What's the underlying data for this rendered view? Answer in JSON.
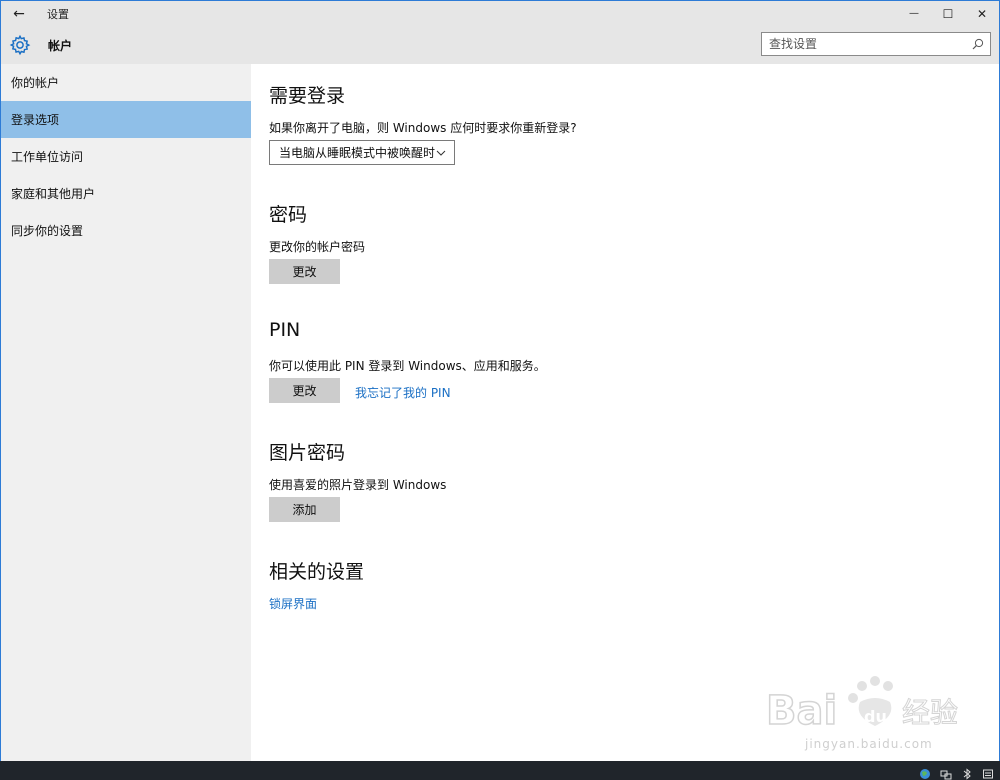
{
  "window": {
    "title": "设置",
    "back_glyph": "←",
    "min_glyph": "—",
    "max_glyph": "☐",
    "close_glyph": "✕"
  },
  "header": {
    "title": "帐户",
    "gear_icon": "gear-icon",
    "search_placeholder": "查找设置"
  },
  "sidebar": {
    "items": [
      {
        "label": "你的帐户",
        "active": false
      },
      {
        "label": "登录选项",
        "active": true
      },
      {
        "label": "工作单位访问",
        "active": false
      },
      {
        "label": "家庭和其他用户",
        "active": false
      },
      {
        "label": "同步你的设置",
        "active": false
      }
    ]
  },
  "main": {
    "require_signin": {
      "title": "需要登录",
      "desc": "如果你离开了电脑，则 Windows 应何时要求你重新登录?",
      "dropdown_value": "当电脑从睡眠模式中被唤醒时"
    },
    "password": {
      "title": "密码",
      "desc": "更改你的帐户密码",
      "button": "更改"
    },
    "pin": {
      "title": "PIN",
      "desc": "你可以使用此 PIN 登录到 Windows、应用和服务。",
      "button": "更改",
      "link": "我忘记了我的 PIN"
    },
    "picture_password": {
      "title": "图片密码",
      "desc": "使用喜爱的照片登录到 Windows",
      "button": "添加"
    },
    "related": {
      "title": "相关的设置",
      "link": "锁屏界面"
    }
  },
  "watermark": {
    "text": "jingyan.baidu.com"
  },
  "colors": {
    "accent": "#8fbfe8",
    "link": "#1a6fc4",
    "titlebar": "#e6e6e6",
    "sidebar": "#f0f0f0",
    "button": "#cccccc",
    "taskbar": "#20252b"
  }
}
